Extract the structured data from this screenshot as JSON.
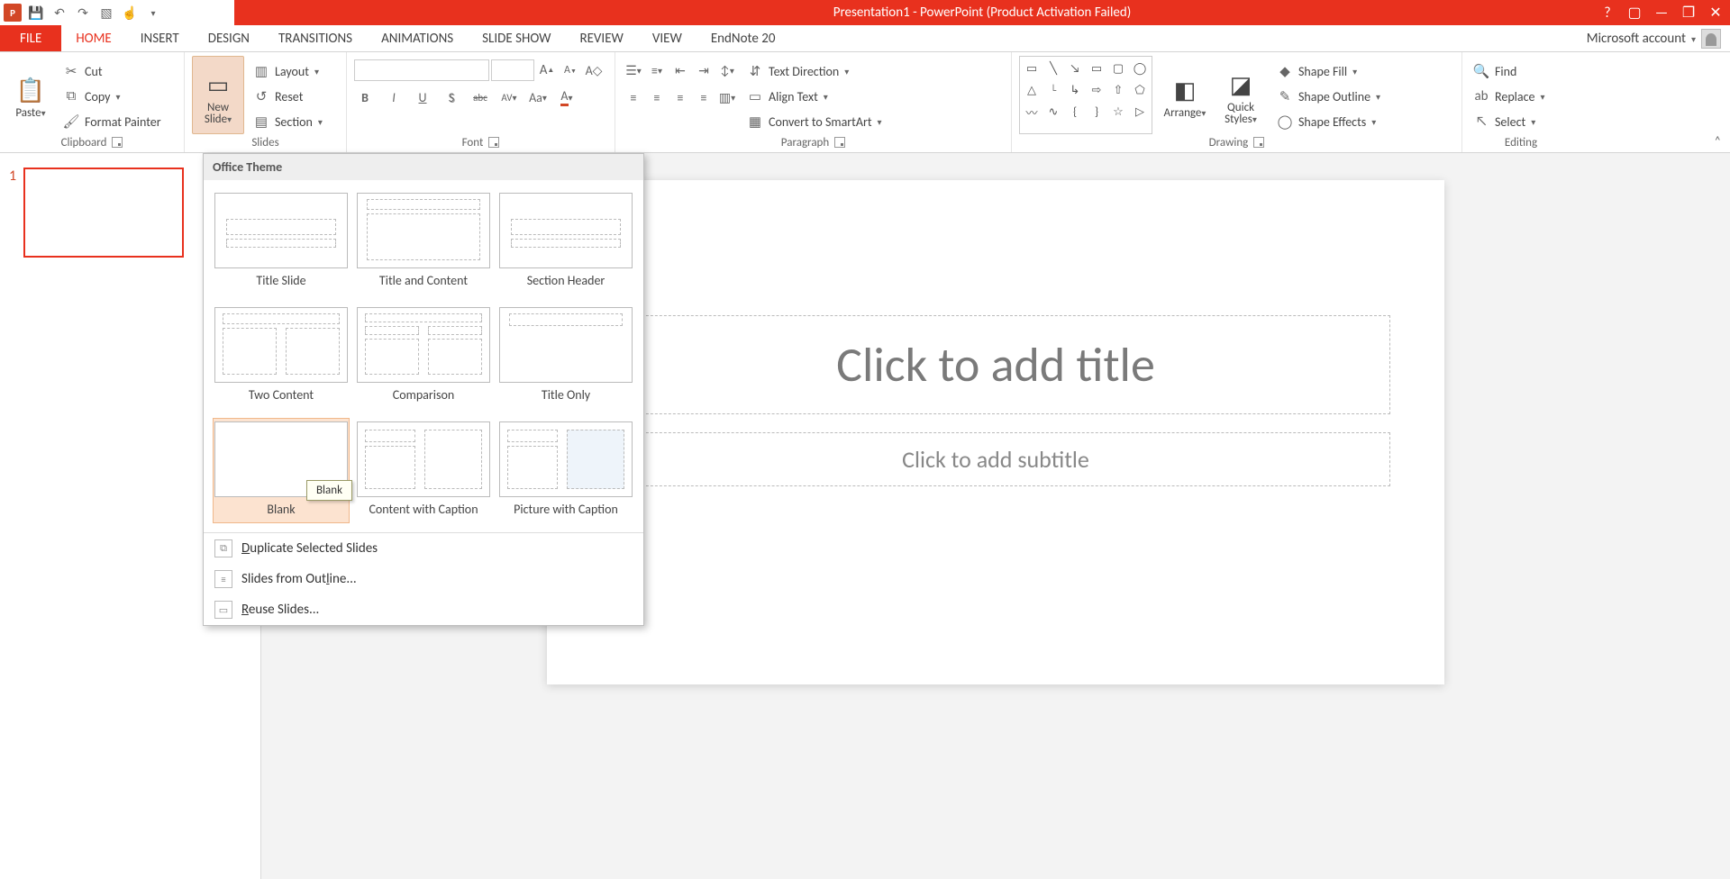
{
  "window_title": "Presentation1 -  PowerPoint (Product Activation Failed)",
  "account_label": "Microsoft account",
  "tabs": {
    "file": "FILE",
    "home": "HOME",
    "insert": "INSERT",
    "design": "DESIGN",
    "transitions": "TRANSITIONS",
    "animations": "ANIMATIONS",
    "slideshow": "SLIDE SHOW",
    "review": "REVIEW",
    "view": "VIEW",
    "endnote": "EndNote 20"
  },
  "clipboard": {
    "paste": "Paste",
    "cut": "Cut",
    "copy": "Copy",
    "format_painter": "Format Painter",
    "group": "Clipboard"
  },
  "slides": {
    "new_slide": "New\nSlide",
    "layout": "Layout",
    "reset": "Reset",
    "section": "Section",
    "group": "Slides"
  },
  "font": {
    "bold": "B",
    "italic": "I",
    "underline": "U",
    "shadow": "S",
    "strike": "abc",
    "spacing": "AV",
    "case": "Aa",
    "clear": "A",
    "color": "A",
    "grow": "A",
    "shrink": "A",
    "group": "Font"
  },
  "paragraph": {
    "text_direction": "Text Direction",
    "align_text": "Align Text",
    "smartart": "Convert to SmartArt",
    "group": "Paragraph"
  },
  "drawing": {
    "arrange": "Arrange",
    "quick_styles": "Quick\nStyles",
    "shape_fill": "Shape Fill",
    "shape_outline": "Shape Outline",
    "shape_effects": "Shape Effects",
    "group": "Drawing"
  },
  "editing": {
    "find": "Find",
    "replace": "Replace",
    "select": "Select",
    "group": "Editing"
  },
  "gallery": {
    "header": "Office Theme",
    "layouts": [
      "Title Slide",
      "Title and Content",
      "Section Header",
      "Two Content",
      "Comparison",
      "Title Only",
      "Blank",
      "Content with Caption",
      "Picture with Caption"
    ],
    "tooltip": "Blank",
    "duplicate": "Duplicate Selected Slides",
    "from_outline": "Slides from Outline...",
    "reuse": "Reuse Slides..."
  },
  "slide_canvas": {
    "title_placeholder": "Click to add title",
    "subtitle_placeholder": "Click to add subtitle"
  },
  "thumb": {
    "num": "1"
  }
}
